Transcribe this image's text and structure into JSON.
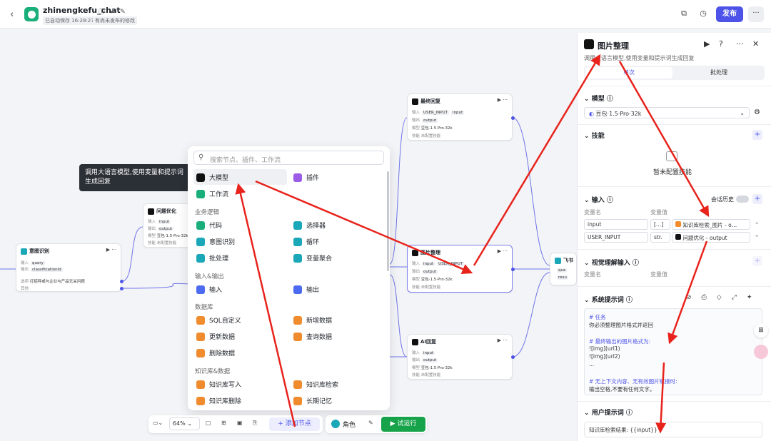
{
  "topbar": {
    "back": "‹",
    "app_name": "zhinengkefu_chat",
    "status_icons": "ⓘ ✔ ✎",
    "autosave": "已自动保存 16:28:27",
    "unpublished": "有尚未发布的修改",
    "publish": "发布",
    "more": "···"
  },
  "nodes": {
    "intent": {
      "title": "意图识别",
      "in_label": "输入",
      "in_val": "query",
      "out_label": "输出",
      "out_val": "classificationId",
      "opt_label": "选项",
      "opt_val": "打招呼或与企业与产品无关问题",
      "other_label": "其他"
    },
    "optimize": {
      "title": "问题优化",
      "in_label": "输入",
      "in_val": "input",
      "out_label": "输出",
      "out_val": "output",
      "model_label": "模型",
      "model_val": "豆包·1.5·Pro·32k",
      "skill_label": "技能",
      "skill_val": "未配置技能"
    },
    "final": {
      "title": "最终回复",
      "in_label": "输入",
      "in_val": "USER_INPUT",
      "in_val2": "input",
      "out_label": "输出",
      "out_val": "output",
      "model_label": "模型",
      "model_val": "豆包·1.5·Pro·32k",
      "skill_label": "技能",
      "skill_val": "未配置技能"
    },
    "image": {
      "title": "图片整理",
      "in_label": "输入",
      "in_val": "input",
      "in_val2": "USER_INPUT",
      "out_label": "输出",
      "out_val": "output",
      "model_label": "模型",
      "model_val": "豆包·1.5·Pro·32k",
      "skill_label": "技能",
      "skill_val": "未配置技能"
    },
    "ai": {
      "title": "AI回复",
      "in_label": "输入",
      "in_val": "input",
      "out_label": "输出",
      "out_val": "output",
      "model_label": "模型",
      "model_val": "豆包·1.5·Pro·32k",
      "skill_label": "技能",
      "skill_val": "未配置技能"
    },
    "feishu": {
      "title": "飞书",
      "in_val": "que",
      "out_val": "resu"
    }
  },
  "menu": {
    "search_placeholder": "搜索节点、插件、工作流",
    "top": [
      {
        "label": "大模型",
        "color": "#111111"
      },
      {
        "label": "插件",
        "color": "#9b5de5"
      },
      {
        "label": "工作流",
        "color": "#1aaf7a"
      }
    ],
    "sections": [
      "业务逻辑",
      "输入&输出",
      "数据库",
      "知识库&数据"
    ],
    "logic": [
      {
        "label": "代码",
        "color": "#1aaf7a"
      },
      {
        "label": "选择器",
        "color": "#1aa7b8"
      },
      {
        "label": "意图识别",
        "color": "#1aa7b8"
      },
      {
        "label": "循环",
        "color": "#1aa7b8"
      },
      {
        "label": "批处理",
        "color": "#1aa7b8"
      },
      {
        "label": "变量聚合",
        "color": "#1aa7b8"
      }
    ],
    "io": [
      {
        "label": "输入",
        "color": "#4d6bf0"
      },
      {
        "label": "输出",
        "color": "#4d6bf0"
      }
    ],
    "db": [
      {
        "label": "SQL自定义",
        "color": "#f08c2e"
      },
      {
        "label": "新增数据",
        "color": "#f08c2e"
      },
      {
        "label": "更新数据",
        "color": "#f08c2e"
      },
      {
        "label": "查询数据",
        "color": "#f08c2e"
      },
      {
        "label": "删除数据",
        "color": "#f08c2e"
      }
    ],
    "kb": [
      {
        "label": "知识库写入",
        "color": "#f08c2e"
      },
      {
        "label": "知识库检索",
        "color": "#f08c2e"
      },
      {
        "label": "知识库删除",
        "color": "#f08c2e"
      },
      {
        "label": "长期记忆",
        "color": "#f08c2e"
      }
    ]
  },
  "tooltip": "调用大语言模型,使用变量和提示词生成回复",
  "bottom": {
    "zoom": "64%",
    "add_node": "+ 添加节点",
    "role": "角色",
    "run": "▶ 试运行"
  },
  "panel": {
    "title": "图片整理",
    "desc": "调用大语言模型,使用变量和提示词生成回复",
    "tab_single": "单次",
    "tab_batch": "批处理",
    "model_section": "模型 ⓘ",
    "model_value": "豆包·1.5·Pro·32k",
    "skill_section": "技能",
    "skill_empty": "暂未配置技能",
    "input_section": "输入 ⓘ",
    "chat_history": "会话历史",
    "var_name": "变量名",
    "var_value": "变量值",
    "inputs": [
      {
        "name": "input",
        "type": "[…]",
        "ref": "知识库检索_图片 - o…"
      },
      {
        "name": "USER_INPUT",
        "type": "str.",
        "ref": "问题优化 - output"
      }
    ],
    "vision_section": "视觉理解输入 ⓘ",
    "system_section": "系统提示词 ⓘ",
    "system_lines": [
      "# 任务",
      "你必须整理图片格式并返回",
      "",
      "# 最终输出的图片格式为:",
      "![img](url1)",
      "![img](url2)",
      "...",
      "",
      "# 无上下文内容、无有效图片链接时:",
      "输出空格,不要有任何文字。"
    ],
    "user_section": "用户提示词 ⓘ",
    "user_prompt": "知识库检索结果: {{input}}"
  },
  "colors": {
    "accent": "#4d53e8",
    "arrow": "#e8231c",
    "run": "#16a34a"
  }
}
